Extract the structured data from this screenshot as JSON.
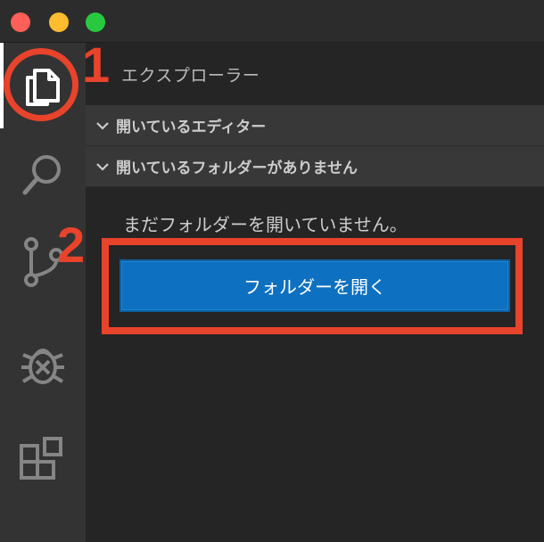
{
  "sidebar": {
    "title": "エクスプローラー",
    "sections": [
      {
        "label": "開いているエディター"
      },
      {
        "label": "開いているフォルダーがありません"
      }
    ],
    "empty_message": "まだフォルダーを開いていません。",
    "open_folder_label": "フォルダーを開く"
  },
  "activity_bar": {
    "items": [
      {
        "icon": "explorer-icon",
        "active": true
      },
      {
        "icon": "search-icon"
      },
      {
        "icon": "source-control-icon"
      },
      {
        "icon": "debug-icon"
      },
      {
        "icon": "extensions-icon"
      }
    ]
  },
  "annotations": {
    "step1": "1",
    "step2": "2"
  },
  "colors": {
    "accent_button": "#0e70c0",
    "annotation_red": "#e8432b"
  }
}
